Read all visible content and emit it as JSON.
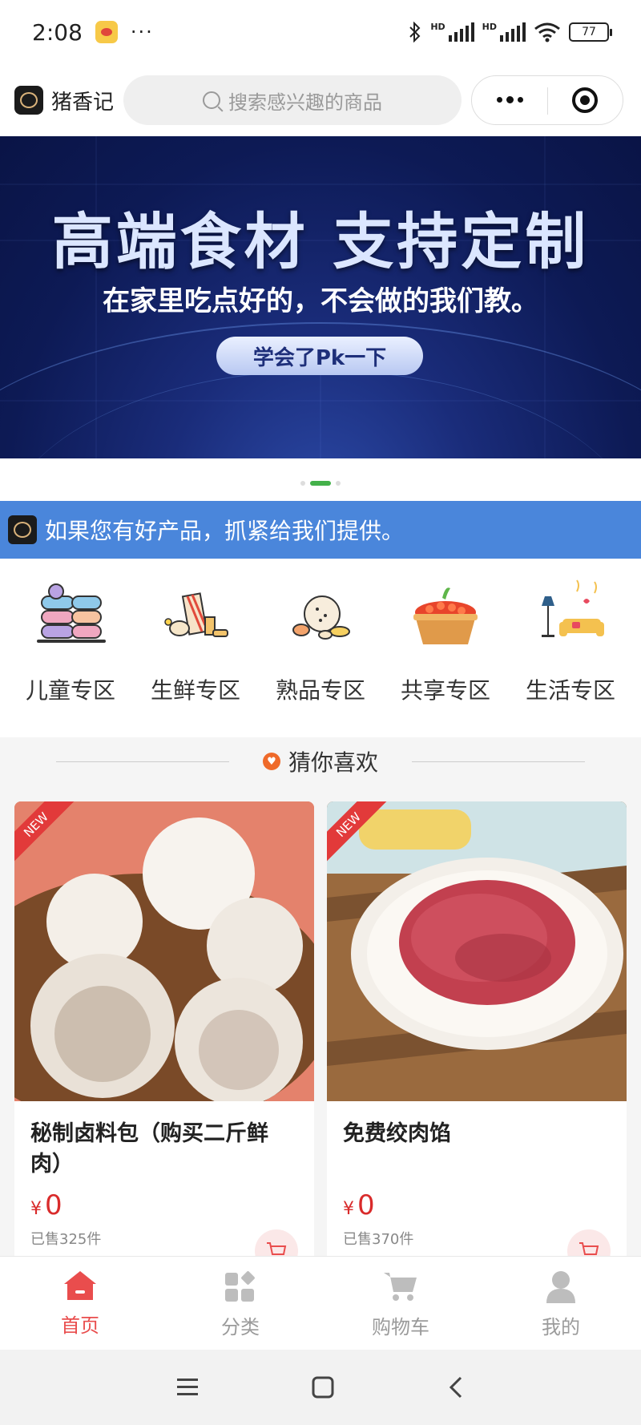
{
  "status_bar": {
    "time": "2:08",
    "dots": "···",
    "battery": "77",
    "signal_label_1": "HD",
    "signal_label_2": "HD"
  },
  "header": {
    "app_name": "猪香记",
    "search_placeholder": "搜索感兴趣的商品"
  },
  "banner": {
    "title": "高端食材  支持定制",
    "subtitle": "在家里吃点好的，不会做的我们教。",
    "button": "学会了Pk一下",
    "page_count": 3,
    "active_page": 2
  },
  "notice": {
    "text": "如果您有好产品，抓紧给我们提供。"
  },
  "categories": [
    {
      "label": "儿童专区",
      "icon": "macaron-icon"
    },
    {
      "label": "生鲜专区",
      "icon": "fresh-food-icon"
    },
    {
      "label": "熟品专区",
      "icon": "cooked-food-icon"
    },
    {
      "label": "共享专区",
      "icon": "basket-icon"
    },
    {
      "label": "生活专区",
      "icon": "living-room-icon"
    }
  ],
  "recommend": {
    "title": "猜你喜欢",
    "products": [
      {
        "badge": "NEW",
        "name": "秘制卤料包（购买二斤鲜肉）",
        "currency": "¥",
        "price": "0",
        "sold": "已售325件"
      },
      {
        "badge": "NEW",
        "name": "免费绞肉馅",
        "currency": "¥",
        "price": "0",
        "sold": "已售370件"
      }
    ]
  },
  "tabbar": [
    {
      "label": "首页",
      "icon": "home-icon",
      "active": true
    },
    {
      "label": "分类",
      "icon": "category-icon",
      "active": false
    },
    {
      "label": "购物车",
      "icon": "cart-icon",
      "active": false
    },
    {
      "label": "我的",
      "icon": "user-icon",
      "active": false
    }
  ],
  "colors": {
    "accent": "#e94d4d",
    "notice_bg": "#4a86db",
    "price": "#d92b2b",
    "dot_active": "#44b14a"
  }
}
